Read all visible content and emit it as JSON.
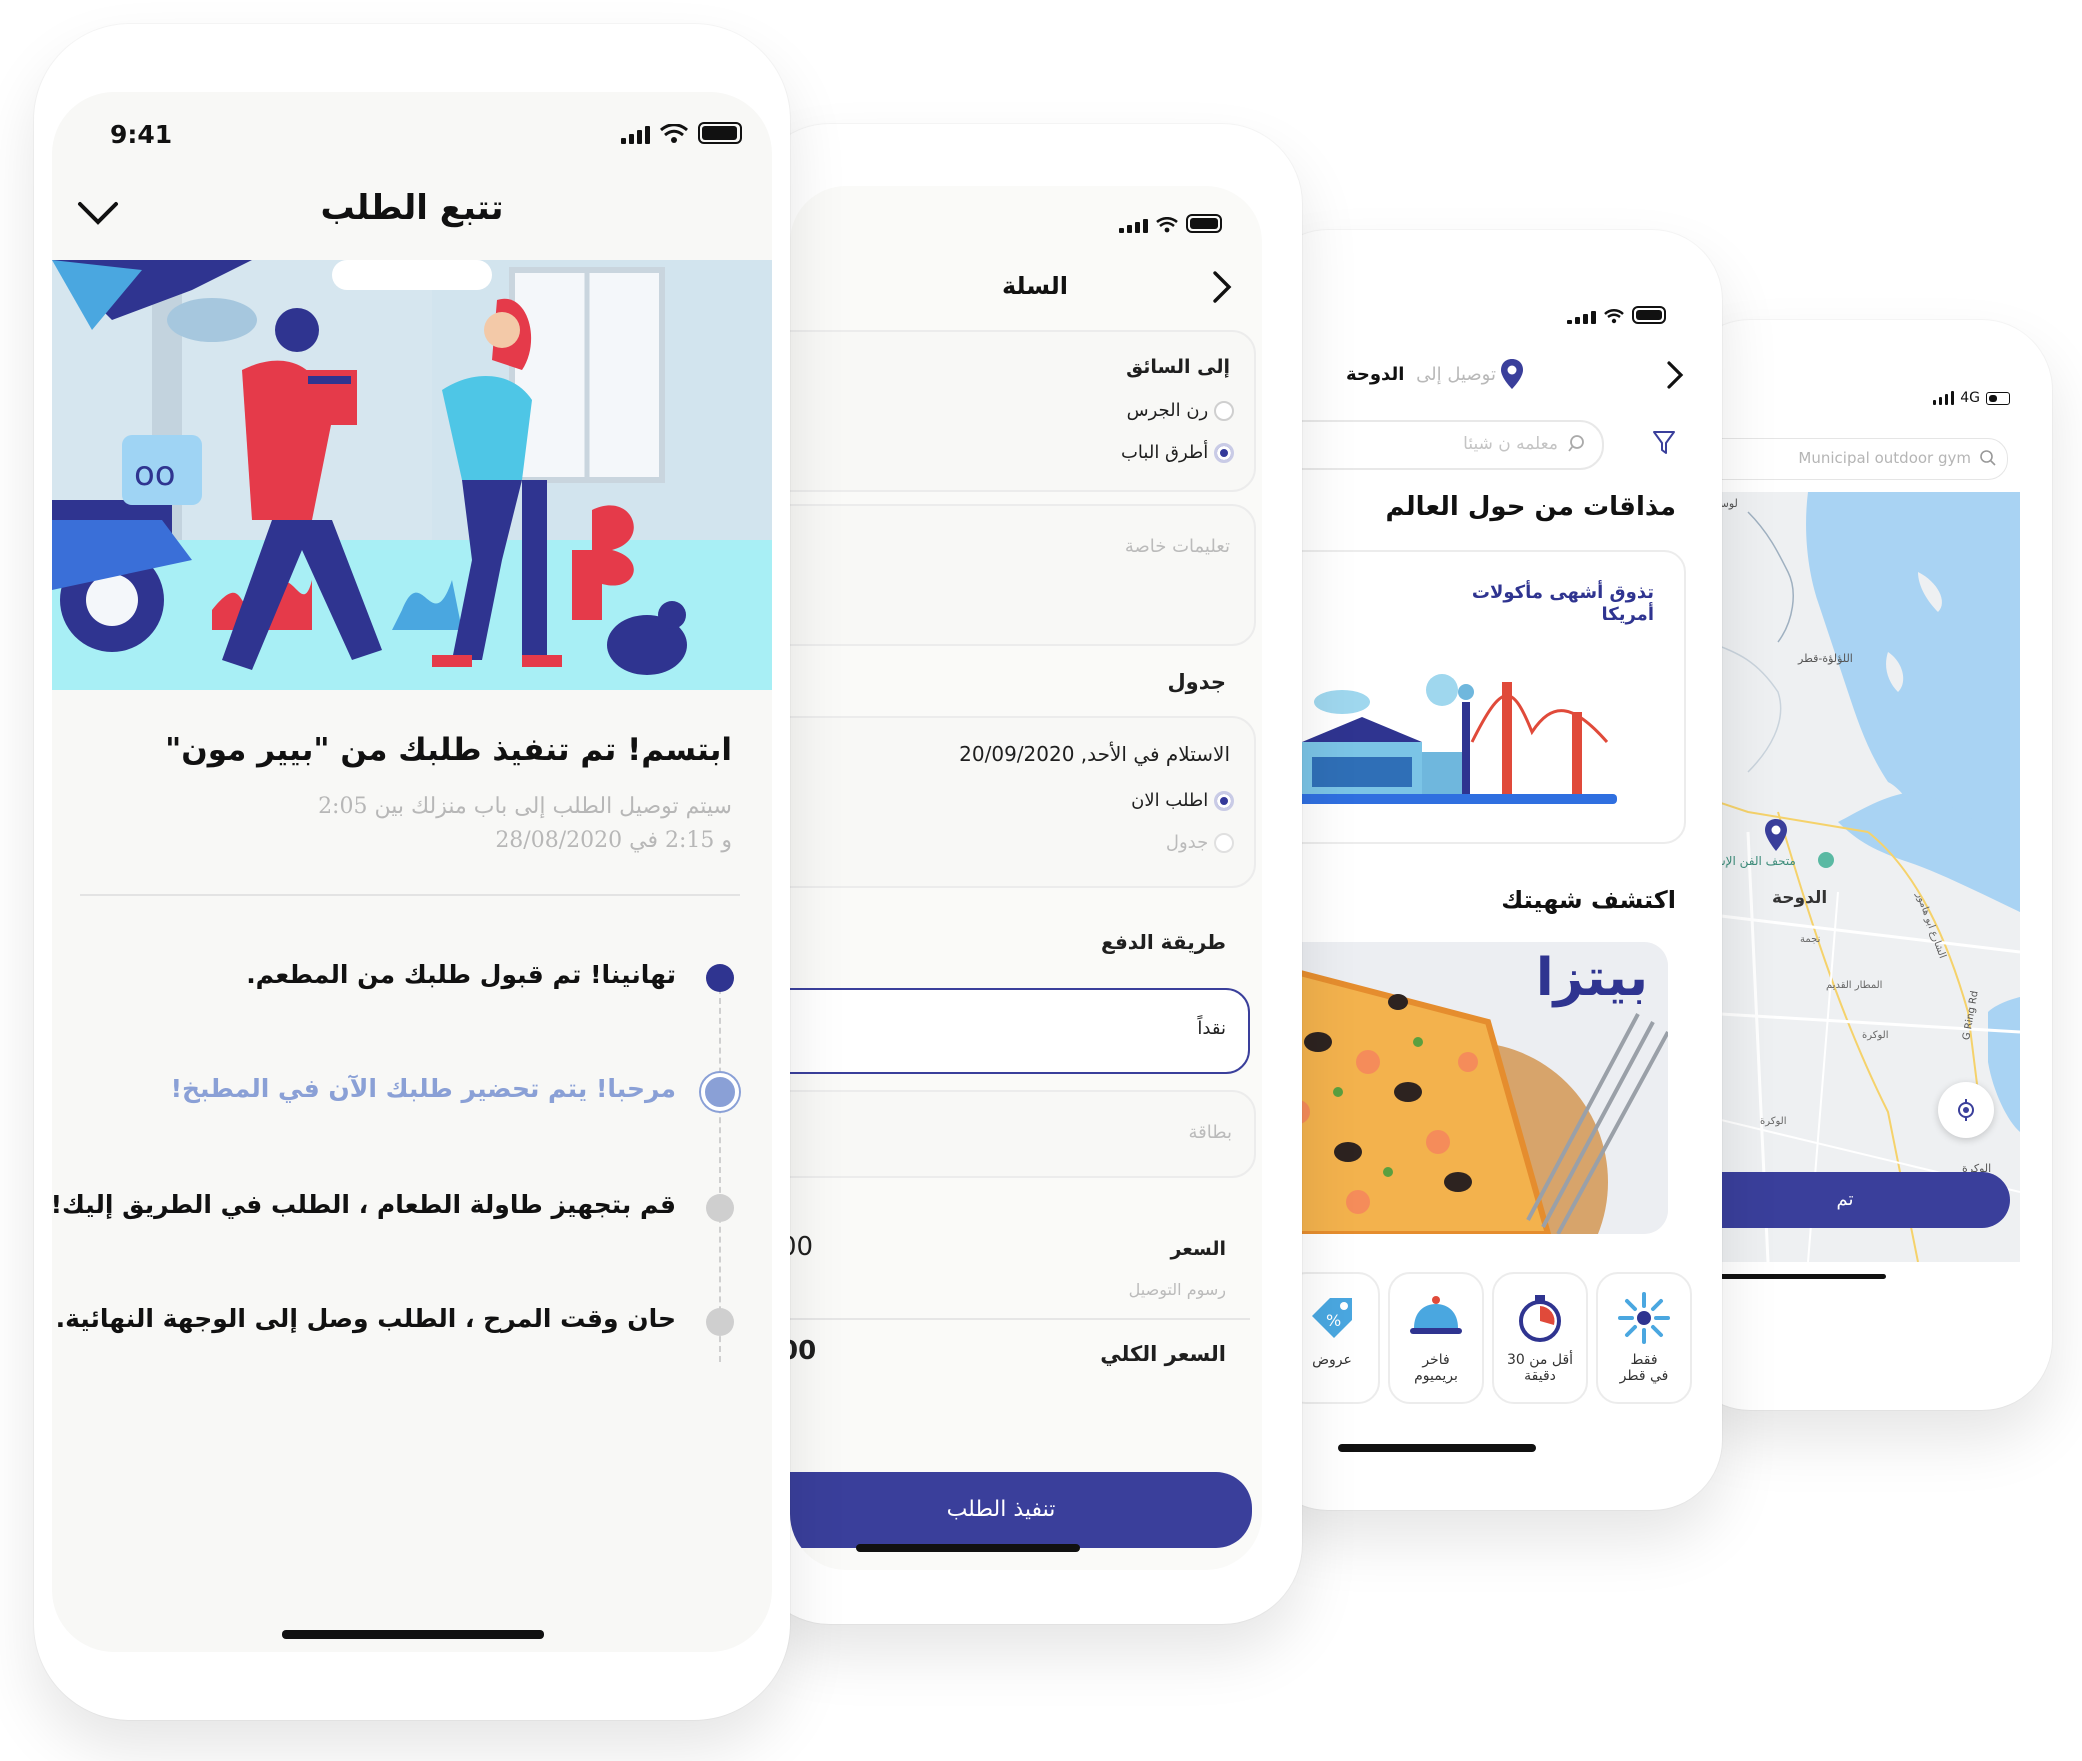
{
  "colors": {
    "primary": "#3a3f9b",
    "timeline_active": "#2f3490",
    "timeline_current": "#8aa0d6",
    "timeline_pending": "#cfcfcf",
    "map_water": "#a9d3f3",
    "map_land": "#eef0f2"
  },
  "tracking": {
    "time": "9:41",
    "title": "تتبع الطلب",
    "headline": "ابتسم! تم تنفيذ طلبك من \"بيير مون\"",
    "subtitle_line1": "سيتم توصيل الطلب إلى باب منزلك بين 2:05",
    "subtitle_line2": "و 2:15 في 28/08/2020",
    "steps": [
      {
        "text": "تهانينا! تم قبول طلبك من المطعم.",
        "state": "done"
      },
      {
        "text": "مرحبا! يتم تحضير طلبك الآن في المطبخ!",
        "state": "current"
      },
      {
        "text": "قم بتجهيز طاولة الطعام ، الطلب في الطريق إليك!",
        "state": "pending"
      },
      {
        "text": "حان وقت المرح ، الطلب وصل إلى الوجهة النهائية.",
        "state": "pending"
      }
    ]
  },
  "cart": {
    "title": "السلة",
    "driver_label": "إلى السائق",
    "driver_options": [
      {
        "label": "رن الجرس",
        "selected": false
      },
      {
        "label": "أطرق الباب",
        "selected": true
      }
    ],
    "instructions_placeholder": "تعليمات خاصة",
    "schedule_label": "جدول",
    "pickup_text": "الاستلام في الأحد, 20/09/2020",
    "schedule_options": [
      {
        "label": "اطلب الان",
        "selected": true
      },
      {
        "label": "جدول",
        "selected": false
      }
    ],
    "payment_label": "طريقة الدفع",
    "payment_cash": "نقداً",
    "payment_card": "بطاقة",
    "price_label": "السعر",
    "price_value": "00",
    "delivery_fee_label": "رسوم التوصيل",
    "total_label": "السعر الكلي",
    "total_value": "00",
    "submit_label": "تنفيذ الطلب"
  },
  "home": {
    "delivery_prefix": "توصيل إلى",
    "city": "الدوحة",
    "search_placeholder": "معلمه ن شيئا",
    "section_world": "مذاقات من حول العالم",
    "banner_text_line1": "تذوق أشهى مأكولات",
    "banner_text_line2": "أمريكا",
    "section_discover": "اكتشف شهيتك",
    "pizza_label": "بيتزا",
    "categories": [
      {
        "line1": "فقط",
        "line2": "في قطر",
        "icon": "burst-icon"
      },
      {
        "line1": "أقل من 30",
        "line2": "دقيقة",
        "icon": "stopwatch-icon"
      },
      {
        "line1": "فاخر",
        "line2": "بريميوم",
        "icon": "cloche-icon"
      },
      {
        "line1": "عروض",
        "line2": "",
        "icon": "tag-icon"
      }
    ]
  },
  "map": {
    "signal_text": "4G",
    "search_placeholder": "Municipal outdoor gym",
    "labels": {
      "lusail": "لوسيل",
      "pearl": "اللؤلؤة-قطر",
      "museum": "متحف الفن الإسلامي",
      "doha": "الدوحة",
      "najma": "نجمة",
      "old_airport": "المطار القديم",
      "wakra1": "الوكرة",
      "wakra2": "الوكرة",
      "wakra3": "الوكرة",
      "ring": "G Ring Rd",
      "abu_hamour": "الشارع ابو هامور"
    },
    "confirm_label": "تم"
  }
}
